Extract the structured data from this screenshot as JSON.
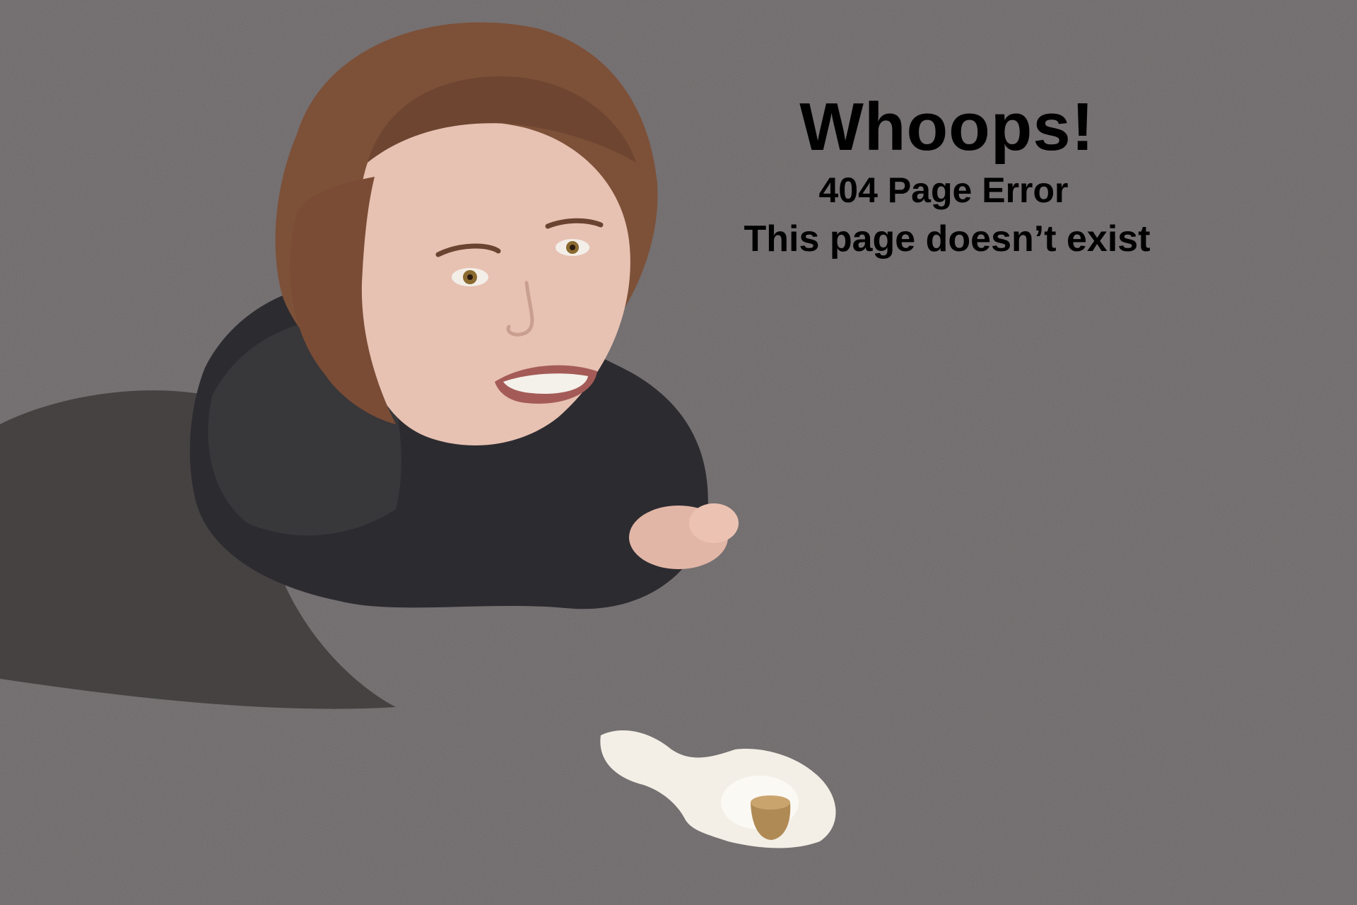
{
  "error_page": {
    "headline": "Whoops!",
    "code_line": "404 Page Error",
    "detail_line": "This page doesn’t exist"
  },
  "colors": {
    "text": "#000000",
    "asphalt": "#7a7577",
    "shadow": "#3d393a",
    "ice_cream": "#f3efe6",
    "cone": "#b08a55"
  },
  "scene": {
    "icons": [
      "person-illustration",
      "shadow-shape",
      "melted-ice-cream-icon",
      "cone-tip-icon"
    ]
  }
}
